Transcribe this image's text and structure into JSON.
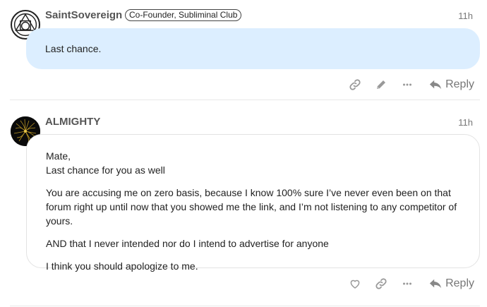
{
  "posts": [
    {
      "username": "SaintSovereign",
      "flair": "Co-Founder, Subliminal Club",
      "time": "11h",
      "body": "Last chance.",
      "reply_label": "Reply"
    },
    {
      "username": "ALMIGHTY",
      "time": "11h",
      "greeting_line1": "Mate,",
      "greeting_line2": "Last chance for you as well",
      "paragraphs": [
        "You are accusing me on zero basis, because I know 100% sure I’ve never even been on that forum right up until now that you showed me the link, and I’m not listening to any competitor of yours.",
        "AND that I never intended nor do I intend to advertise for anyone",
        "I think you should apologize to me."
      ],
      "reply_label": "Reply"
    }
  ]
}
